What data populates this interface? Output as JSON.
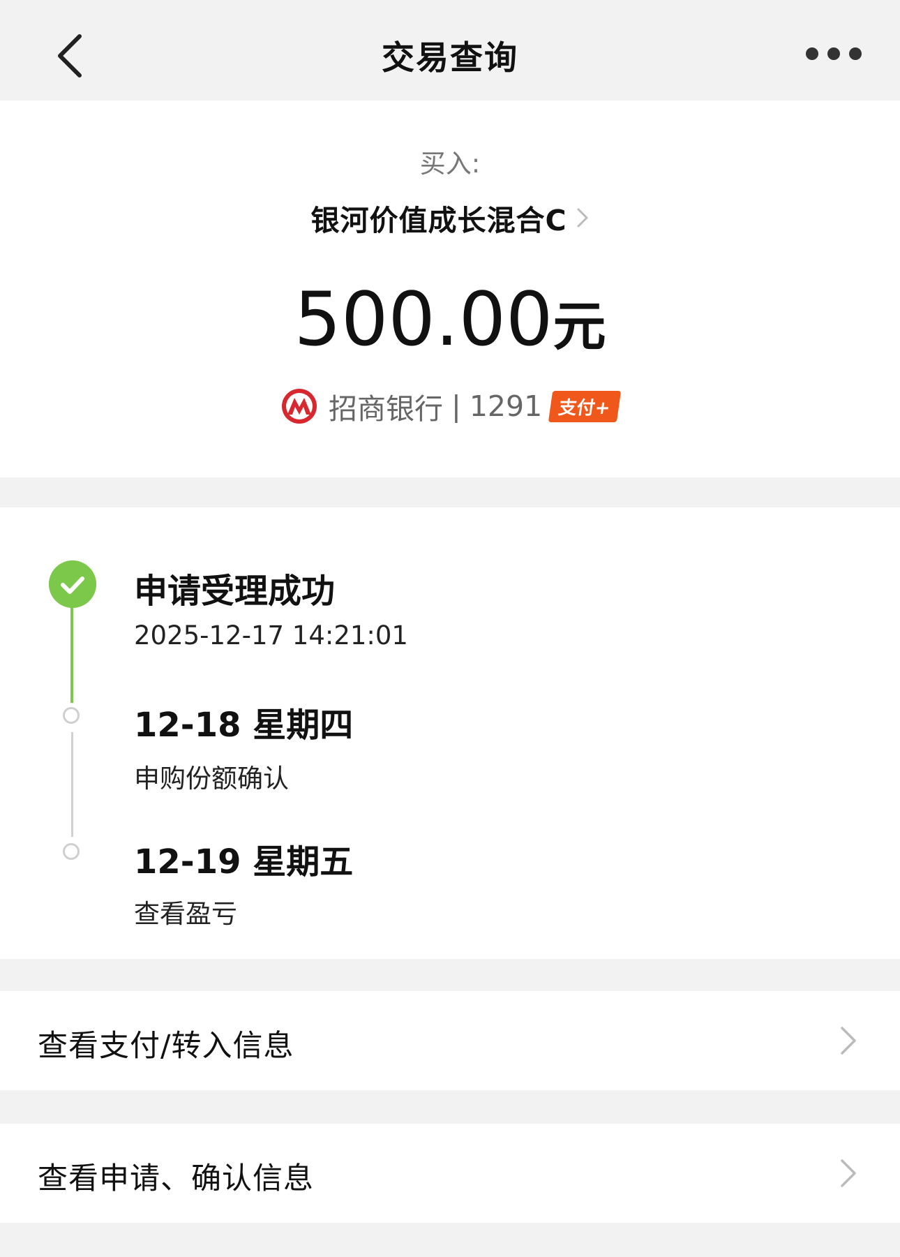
{
  "header": {
    "title": "交易查询",
    "back_icon": "chevron-left-icon",
    "more_icon": "more-dots-icon"
  },
  "summary": {
    "trade_label": "买入:",
    "fund_name": "银河价值成长混合C",
    "amount": "500.00",
    "amount_unit": "元",
    "bank": {
      "logo_icon": "cmb-bank-logo-icon",
      "name": "招商银行",
      "separator": "|",
      "card_suffix": "1291",
      "badge": "支付+"
    }
  },
  "timeline": {
    "steps": [
      {
        "title": "申请受理成功",
        "subtitle": "2025-12-17 14:21:01",
        "status": "done"
      },
      {
        "title": "12-18 星期四",
        "subtitle": "申购份额确认",
        "status": "pending"
      },
      {
        "title": "12-19 星期五",
        "subtitle": "查看盈亏",
        "status": "pending"
      }
    ]
  },
  "links": [
    {
      "label": "查看支付/转入信息"
    },
    {
      "label": "查看申请、确认信息"
    }
  ],
  "colors": {
    "accent_green": "#7cc84b",
    "badge_orange": "#f0571b",
    "bank_red": "#d6282e",
    "background": "#f2f2f2"
  }
}
